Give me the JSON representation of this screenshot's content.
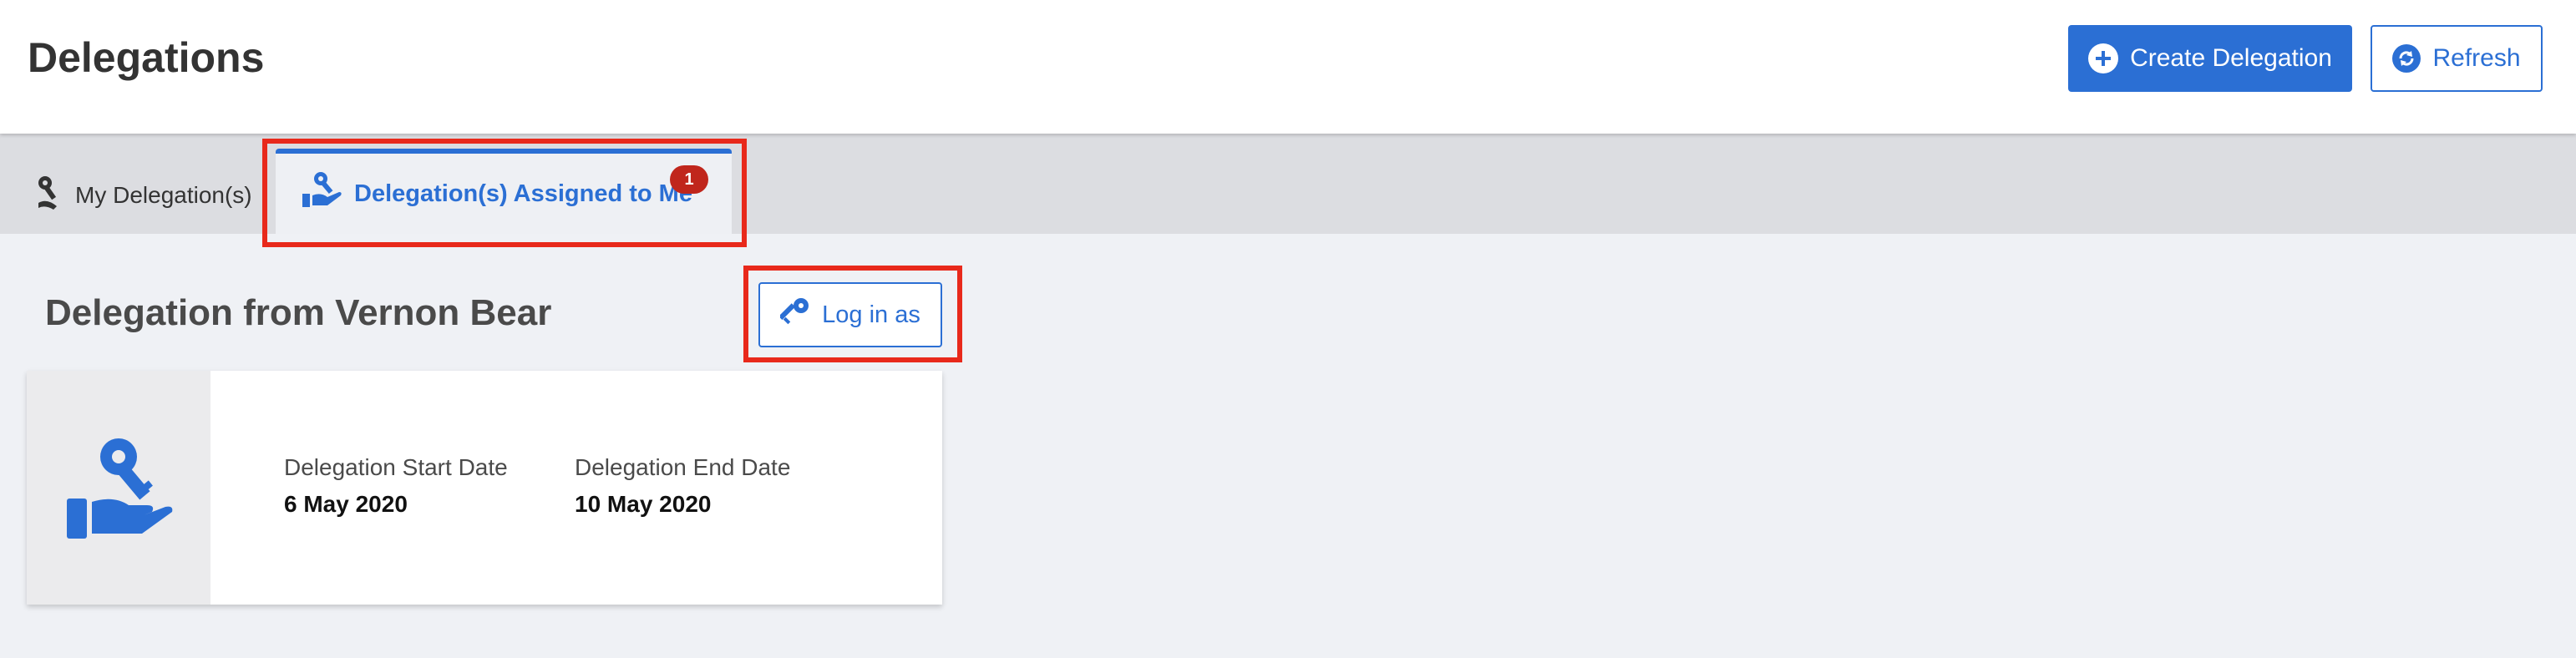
{
  "header": {
    "title": "Delegations",
    "create_label": "Create Delegation",
    "refresh_label": "Refresh"
  },
  "tabs": {
    "mine_label": "My Delegation(s)",
    "assigned_label": "Delegation(s) Assigned to Me",
    "assigned_badge": "1"
  },
  "content": {
    "section_title": "Delegation from Vernon Bear",
    "login_label": "Log in as",
    "card": {
      "start_label": "Delegation Start Date",
      "start_value": "6 May 2020",
      "end_label": "Delegation End Date",
      "end_value": "10 May 2020"
    }
  },
  "icons": {
    "create": "plus-circle-icon",
    "refresh": "refresh-icon",
    "mine_tab": "key-hand-icon",
    "assigned_tab": "key-hand-icon",
    "login": "key-icon",
    "card": "key-hand-icon"
  },
  "colors": {
    "accent": "#2b6fd4",
    "badge": "#c0261c",
    "highlight": "#e8291b"
  }
}
